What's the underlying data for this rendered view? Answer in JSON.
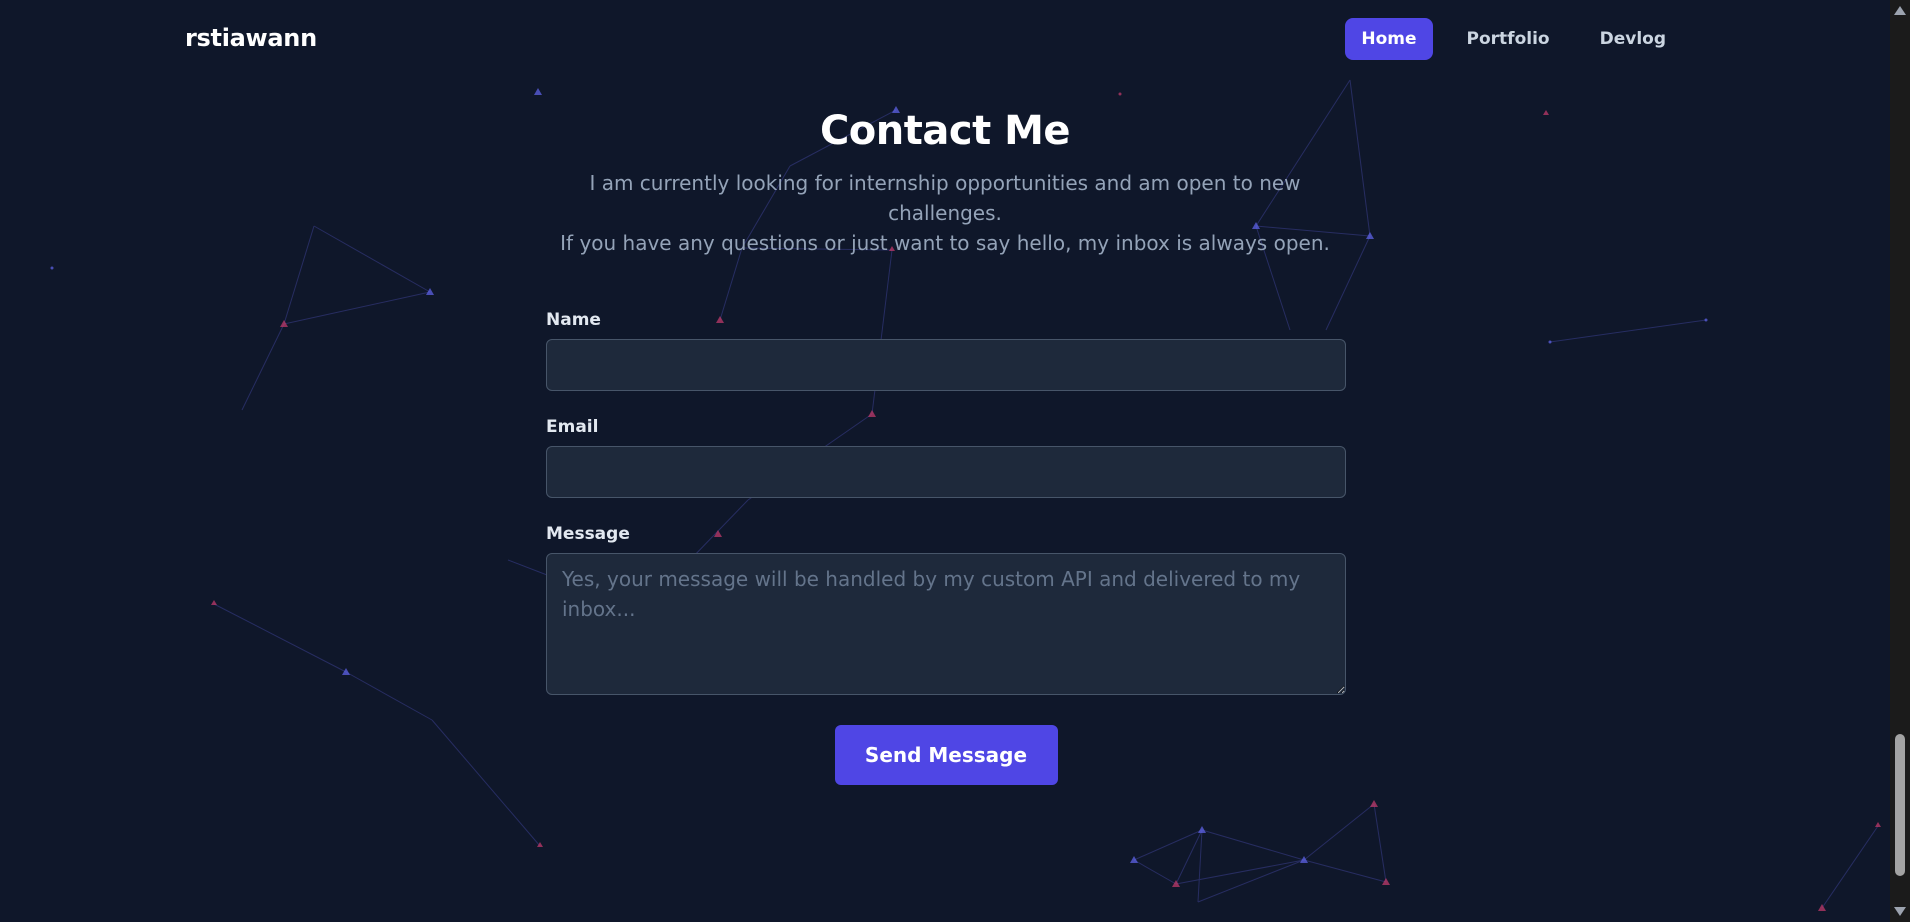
{
  "header": {
    "brand": "rstiawann",
    "nav": [
      {
        "label": "Home",
        "active": true
      },
      {
        "label": "Portfolio",
        "active": false
      },
      {
        "label": "Devlog",
        "active": false
      }
    ]
  },
  "hero": {
    "title": "Contact Me",
    "subtitle_line1": "I am currently looking for internship opportunities and am open to new challenges.",
    "subtitle_line2": "If you have any questions or just want to say hello, my inbox is always open."
  },
  "form": {
    "name_label": "Name",
    "name_value": "",
    "email_label": "Email",
    "email_value": "",
    "message_label": "Message",
    "message_placeholder": "Yes, your message will be handled by my custom API and delivered to my inbox...",
    "message_value": "",
    "submit_label": "Send Message"
  },
  "colors": {
    "background": "#0f172a",
    "accent": "#4f46e5",
    "input_bg": "#1e293b",
    "muted_text": "#94a3b8"
  }
}
